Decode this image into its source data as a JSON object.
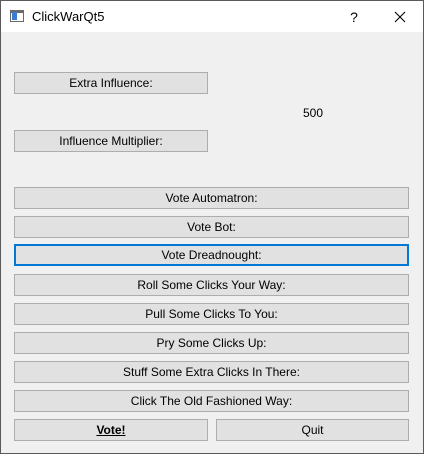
{
  "window": {
    "title": "ClickWarQt5",
    "help_glyph": "?"
  },
  "main": {
    "extra_influence_label": "Extra Influence:",
    "influence_value": "500",
    "influence_multiplier_label": "Influence Multiplier:",
    "vote_buttons": [
      "Vote Automatron:",
      "Vote Bot:",
      "Vote Dreadnought:",
      "Roll Some Clicks Your Way:",
      "Pull Some Clicks To You:",
      "Pry Some Clicks Up:",
      "Stuff Some Extra Clicks In There:",
      "Click The Old Fashioned Way:"
    ],
    "vote_label": "Vote!",
    "quit_label": "Quit",
    "focused_button": "Vote Dreadnought:"
  },
  "colors": {
    "focus_border": "#0078d7",
    "button_face": "#e1e1e1",
    "window_bg": "#f0f0f0"
  }
}
